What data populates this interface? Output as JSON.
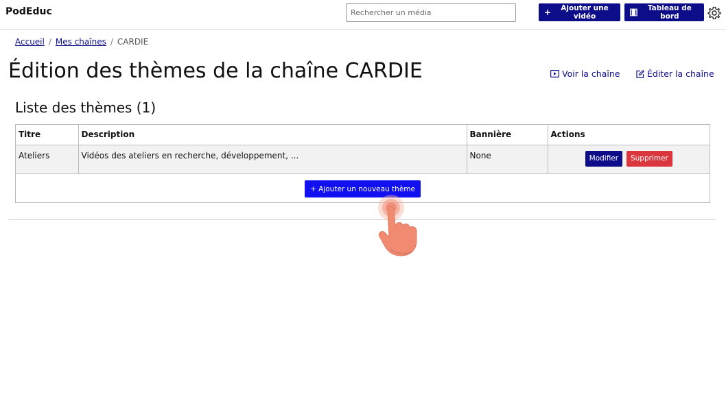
{
  "navbar": {
    "brand": "PodEduc",
    "search_placeholder": "Rechercher un média",
    "add_video_label": "Ajouter une vidéo",
    "dashboard_label": "Tableau de bord"
  },
  "breadcrumb": {
    "home": "Accueil",
    "channels": "Mes chaînes",
    "current": "CARDIE",
    "separator": "/"
  },
  "page": {
    "title": "Édition des thèmes de la chaîne CARDIE",
    "view_channel": "Voir la chaîne",
    "edit_channel": "Éditer la chaîne"
  },
  "themes": {
    "section_title": "Liste des thèmes (1)",
    "columns": [
      "Titre",
      "Description",
      "Bannière",
      "Actions"
    ],
    "rows": [
      {
        "title": "Ateliers",
        "description": "Vidéos des ateliers en recherche, développement, ...",
        "banner": "None",
        "modify_label": "Modifier",
        "delete_label": "Supprimer"
      }
    ],
    "add_label": "+ Ajouter un nouveau thème"
  },
  "colors": {
    "primary": "#0d0d8a",
    "accent": "#1010f0",
    "danger": "#d9363e",
    "cursor": "#f08a70"
  },
  "icons": {
    "add_video": "plus-icon",
    "dashboard": "film-icon",
    "settings": "gear-icon",
    "view_channel": "play-box-icon",
    "edit_channel": "edit-icon",
    "cursor": "hand-pointer-icon"
  }
}
